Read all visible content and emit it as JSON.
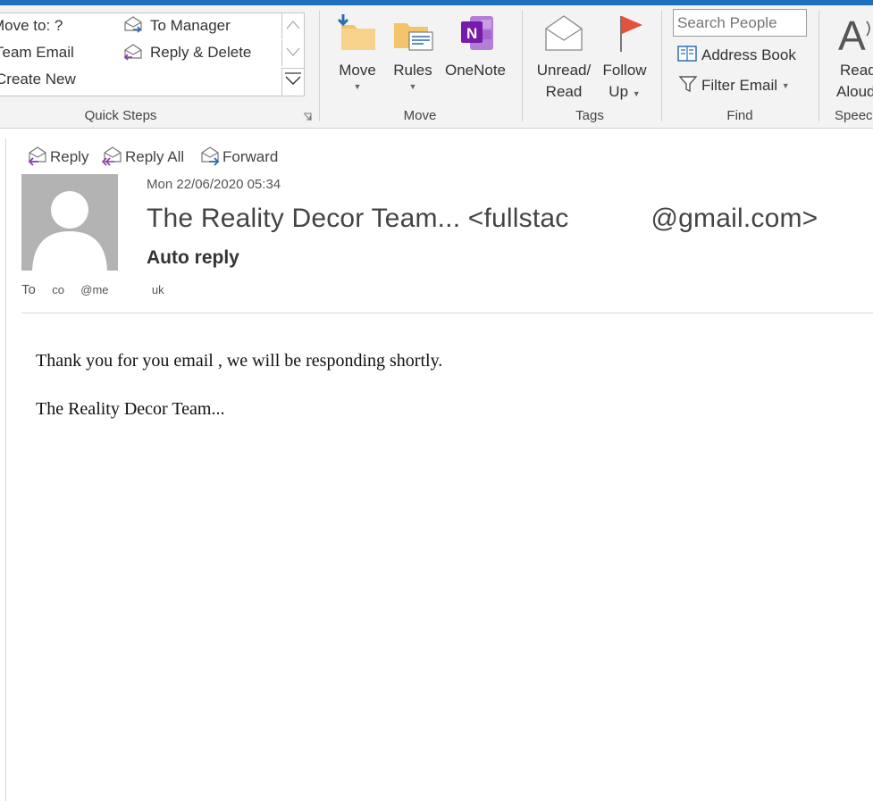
{
  "ribbon": {
    "quick_steps": {
      "items": [
        "Move to: ?",
        "Team Email",
        "Create New",
        "To Manager",
        "Reply & Delete"
      ],
      "group_label": "Quick Steps"
    },
    "move_group": {
      "move_label": "Move",
      "rules_label": "Rules",
      "onenote_label": "OneNote",
      "group_label": "Move"
    },
    "tags_group": {
      "unread_line1": "Unread/",
      "unread_line2": "Read",
      "follow_line1": "Follow",
      "follow_line2": "Up",
      "group_label": "Tags"
    },
    "find_group": {
      "search_placeholder": "Search People",
      "address_book_label": "Address Book",
      "filter_email_label": "Filter Email",
      "group_label": "Find"
    },
    "speech_group": {
      "read_line1": "Read",
      "read_line2": "Aloud",
      "group_label": "Speech"
    }
  },
  "message": {
    "actions": {
      "reply": "Reply",
      "reply_all": "Reply All",
      "forward": "Forward"
    },
    "date": "Mon 22/06/2020 05:34",
    "sender": {
      "name": "The Reality Decor Team...",
      "email_start": "<fullstac",
      "email_end": "@gmail.com>"
    },
    "subject": "Auto reply",
    "to_label": "To",
    "to_parts": [
      "co",
      "@me",
      "uk"
    ],
    "body": [
      "Thank you for you email , we will be responding shortly.",
      "The Reality Decor Team..."
    ]
  },
  "colors": {
    "accent": "#1e6fbd",
    "onenote_purple": "#7719aa",
    "flag_red": "#e0533d",
    "folder_yellow": "#f2c56b"
  }
}
